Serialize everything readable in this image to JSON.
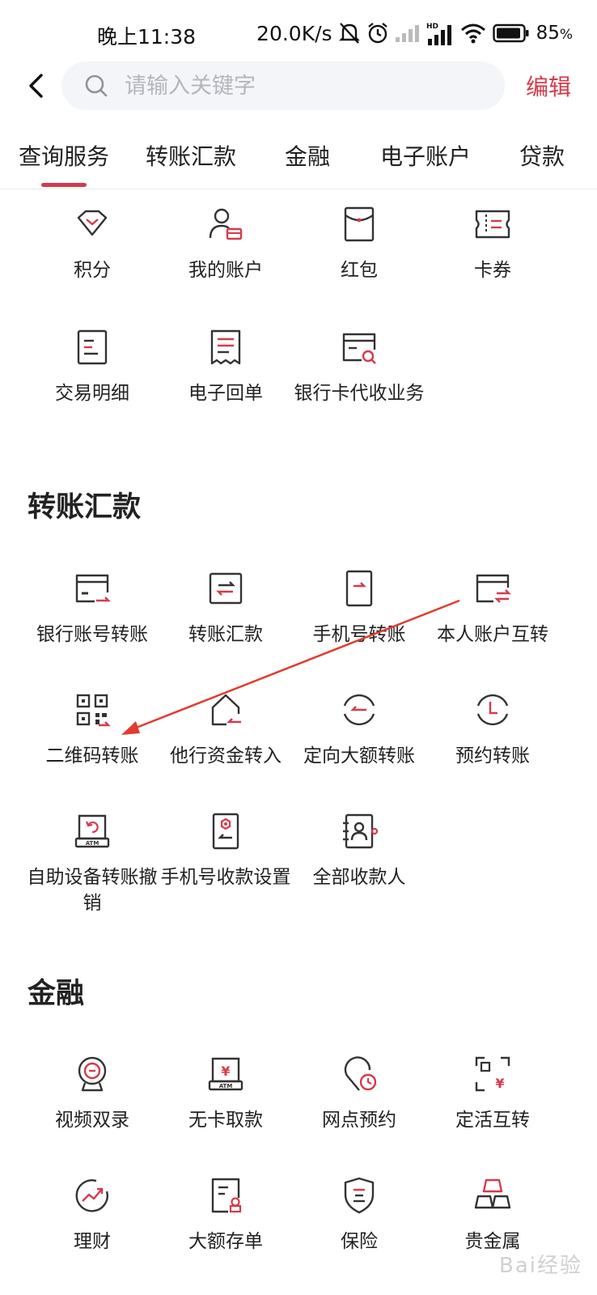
{
  "status_bar": {
    "time": "晚上11:38",
    "speed": "20.0K/s",
    "battery": "85",
    "battery_unit": "%"
  },
  "header": {
    "search_placeholder": "请输入关键字",
    "edit_label": "编辑"
  },
  "tabs": [
    {
      "label": "查询服务",
      "active": true
    },
    {
      "label": "转账汇款"
    },
    {
      "label": "金融"
    },
    {
      "label": "电子账户"
    },
    {
      "label": "贷款"
    }
  ],
  "query_items": [
    {
      "label": "积分",
      "icon": "diamond-icon"
    },
    {
      "label": "我的账户",
      "icon": "user-card-icon"
    },
    {
      "label": "红包",
      "icon": "red-packet-icon"
    },
    {
      "label": "卡券",
      "icon": "coupon-icon"
    },
    {
      "label": "交易明细",
      "icon": "transaction-detail-icon"
    },
    {
      "label": "电子回单",
      "icon": "receipt-icon"
    },
    {
      "label": "银行卡代收业务",
      "icon": "card-search-icon"
    }
  ],
  "sections": {
    "transfer_title": "转账汇款",
    "finance_title": "金融"
  },
  "transfer_items": [
    {
      "label": "银行账号转账",
      "icon": "bank-card-transfer-icon"
    },
    {
      "label": "转账汇款",
      "icon": "transfer-arrows-icon"
    },
    {
      "label": "手机号转账",
      "icon": "phone-transfer-icon"
    },
    {
      "label": "本人账户互转",
      "icon": "own-account-transfer-icon"
    },
    {
      "label": "二维码转账",
      "icon": "qr-code-icon"
    },
    {
      "label": "他行资金转入",
      "icon": "house-inflow-icon"
    },
    {
      "label": "定向大额转账",
      "icon": "directed-transfer-icon"
    },
    {
      "label": "预约转账",
      "icon": "scheduled-transfer-icon"
    },
    {
      "label": "自助设备转账撤销",
      "icon": "atm-revoke-icon"
    },
    {
      "label": "手机号收款设置",
      "icon": "phone-receive-settings-icon"
    },
    {
      "label": "全部收款人",
      "icon": "contacts-book-icon"
    }
  ],
  "finance_items": [
    {
      "label": "视频双录",
      "icon": "webcam-icon"
    },
    {
      "label": "无卡取款",
      "icon": "atm-yuan-icon"
    },
    {
      "label": "网点预约",
      "icon": "location-clock-icon"
    },
    {
      "label": "定活互转",
      "icon": "scan-yuan-icon"
    },
    {
      "label": "理财",
      "icon": "growth-chart-icon"
    },
    {
      "label": "大额存单",
      "icon": "certificate-icon"
    },
    {
      "label": "保险",
      "icon": "shield-icon"
    },
    {
      "label": "贵金属",
      "icon": "gold-bars-icon"
    }
  ],
  "watermark": "Bai经验",
  "colors": {
    "accent": "#d63a4b",
    "icon_stroke": "#333333",
    "annotation": "#e23b2e"
  }
}
